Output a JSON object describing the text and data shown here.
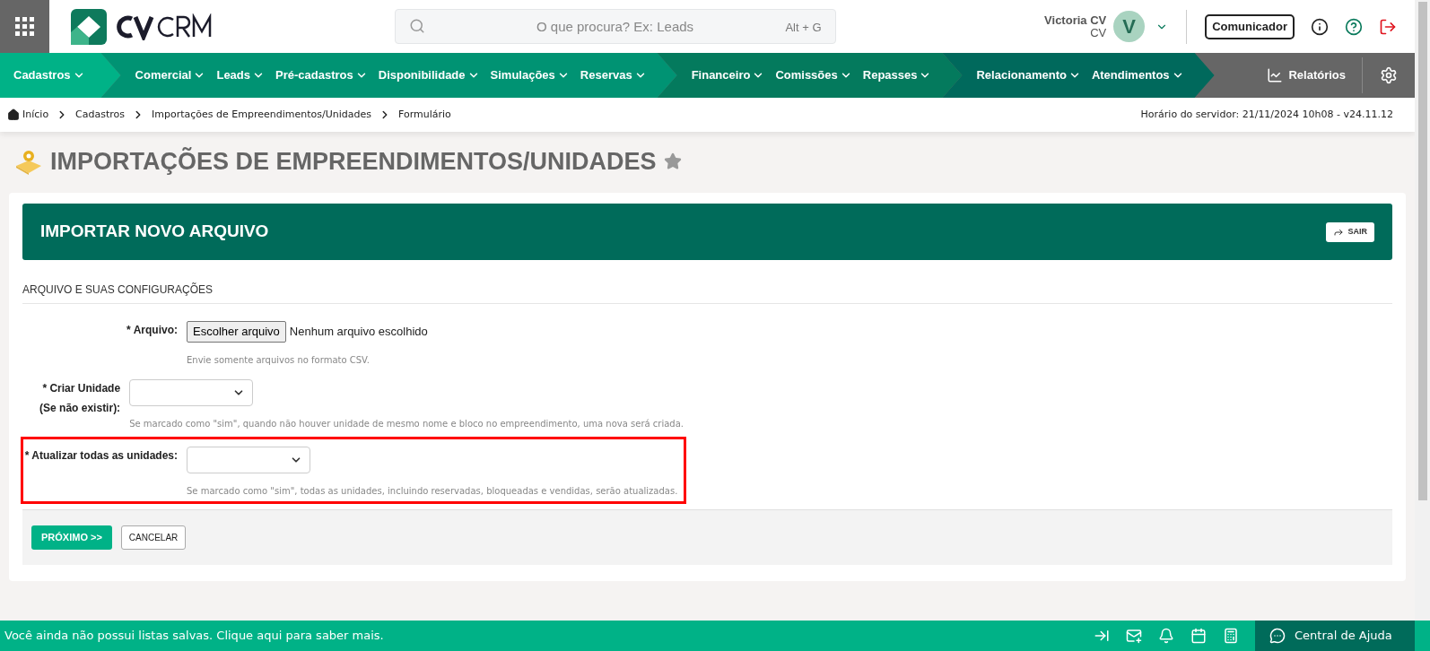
{
  "header": {
    "search": {
      "placeholder": "O que procura? Ex: Leads",
      "shortcut": "Alt + G"
    },
    "user": {
      "name": "Victoria CV",
      "role": "CV",
      "initial": "V"
    },
    "communicator": "Comunicador"
  },
  "nav": {
    "groups": [
      {
        "color": "#00b287",
        "items": [
          "Cadastros"
        ]
      },
      {
        "color": "#009373",
        "items": [
          "Comercial",
          "Leads",
          "Pré-cadastros",
          "Disponibilidade",
          "Simulações",
          "Reservas"
        ]
      },
      {
        "color": "#047a5d",
        "items": [
          "Financeiro",
          "Comissões",
          "Repasses"
        ]
      },
      {
        "color": "#00695c",
        "items": [
          "Relacionamento",
          "Atendimentos"
        ]
      }
    ],
    "reports": "Relatórios"
  },
  "breadcrumb": [
    "Início",
    "Cadastros",
    "Importações de Empreendimentos/Unidades",
    "Formulário"
  ],
  "server_time": "Horário do servidor: 21/11/2024 10h08 - v24.11.12",
  "page_title": "IMPORTAÇÕES DE EMPREENDIMENTOS/UNIDADES",
  "card": {
    "title": "IMPORTAR NOVO ARQUIVO",
    "exit_button": "SAIR",
    "section": "ARQUIVO E SUAS CONFIGURAÇÕES",
    "fields": [
      {
        "kind": "file",
        "label": "* Arquivo:",
        "button": "Escolher arquivo",
        "value": "Nenhum arquivo escolhido",
        "hint": "Envie somente arquivos no formato CSV.",
        "highlighted": false
      },
      {
        "kind": "select",
        "label": "* Criar Unidade (Se não existir):",
        "hint": "Se marcado como \"sim\", quando não houver unidade de mesmo nome e bloco no empreendimento, uma nova será criada.",
        "highlighted": false
      },
      {
        "kind": "select",
        "label": "* Atualizar todas as unidades:",
        "hint": "Se marcado como \"sim\", todas as unidades, incluindo reservadas, bloqueadas e vendidas, serão atualizadas.",
        "highlighted": true
      }
    ],
    "actions": {
      "next": "PRÓXIMO >>",
      "cancel": "CANCELAR"
    }
  },
  "footer": {
    "message": "Você ainda não possui listas salvas. Clique aqui para saber mais.",
    "help": "Central de Ajuda"
  }
}
